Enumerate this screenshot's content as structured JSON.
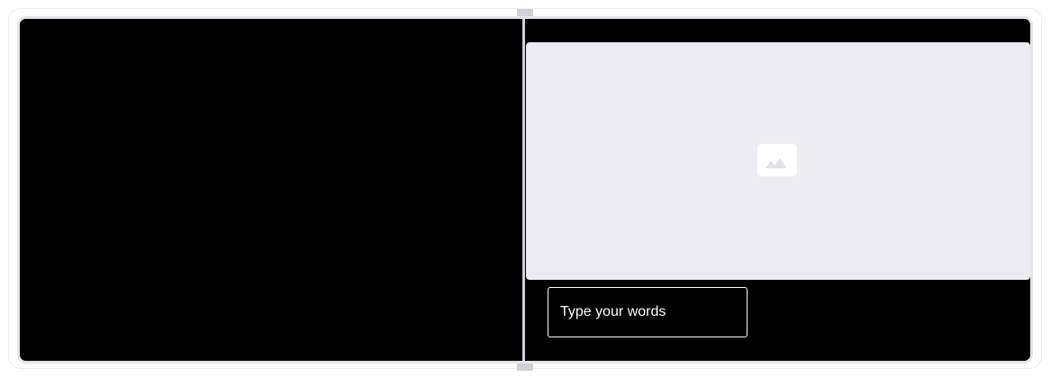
{
  "editor": {
    "text_box": {
      "text": "Type your words"
    },
    "image_placeholder": {
      "icon": "image-icon"
    }
  },
  "colors": {
    "panel_background": "#000000",
    "placeholder_background": "#edebf2",
    "divider": "#cfd0d8",
    "text": "#ffffff"
  }
}
